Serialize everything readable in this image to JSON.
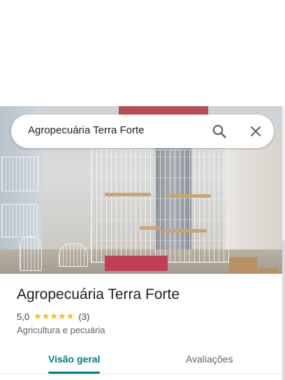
{
  "search": {
    "query": "Agropecuária Terra Forte",
    "search_icon": "search-icon",
    "close_icon": "close-icon"
  },
  "place": {
    "title": "Agropecuária Terra Forte",
    "rating": "5,0",
    "stars": "★★★★★",
    "review_count": "(3)",
    "category": "Agricultura e pecuária"
  },
  "tabs": [
    {
      "label": "Visão geral",
      "active": true
    },
    {
      "label": "Avaliações",
      "active": false
    }
  ],
  "colors": {
    "accent": "#017f7f",
    "star": "#fbbc04",
    "text_primary": "#202124",
    "text_secondary": "#5f6368"
  }
}
